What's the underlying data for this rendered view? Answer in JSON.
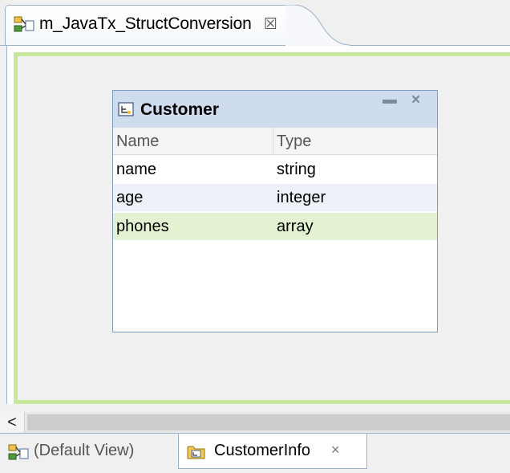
{
  "editor_tab": {
    "title": "m_JavaTx_StructConversion",
    "close_icon": "close-x-icon"
  },
  "customer": {
    "title": "Customer",
    "columns": {
      "name": "Name",
      "type": "Type"
    },
    "rows": [
      {
        "name": "name",
        "type": "string"
      },
      {
        "name": "age",
        "type": "integer"
      },
      {
        "name": "phones",
        "type": "array"
      }
    ]
  },
  "scroll": {
    "left_arrow": "<"
  },
  "bottom_tabs": {
    "default_view": "(Default View)",
    "customer_info": "CustomerInfo",
    "close": "×"
  },
  "colors": {
    "canvas_border": "#c6e898",
    "header_bg": "#cfdced",
    "selected_row": "#e3f3d1"
  }
}
